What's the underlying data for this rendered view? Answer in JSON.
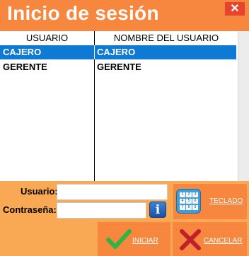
{
  "window": {
    "title": "Inicio de sesión",
    "close_glyph": "✕"
  },
  "user_table": {
    "columns": [
      "USUARIO",
      "NOMBRE DEL USUARIO"
    ],
    "rows": [
      {
        "usuario": "CAJERO",
        "nombre": "CAJERO",
        "selected": true
      },
      {
        "usuario": "GERENTE",
        "nombre": "GERENTE",
        "selected": false
      }
    ]
  },
  "form": {
    "usuario_label": "Usuario:",
    "usuario_value": "",
    "contrasena_label": "Contraseña:",
    "contrasena_value": ""
  },
  "buttons": {
    "teclado": "TECLADO",
    "iniciar": "INICIAR",
    "cancelar": "CANCELAR"
  },
  "keypad_digits": [
    "1",
    "2",
    "3",
    "4",
    "5",
    "6",
    "7",
    "8",
    "9"
  ],
  "icons": {
    "info": "info-icon",
    "keypad": "keypad-icon",
    "check": "check-icon",
    "cancel": "x-icon"
  },
  "colors": {
    "titlebar": "#f7863e",
    "panel": "#f9a953",
    "selection": "#0f7ad4",
    "close": "#e8442c"
  }
}
